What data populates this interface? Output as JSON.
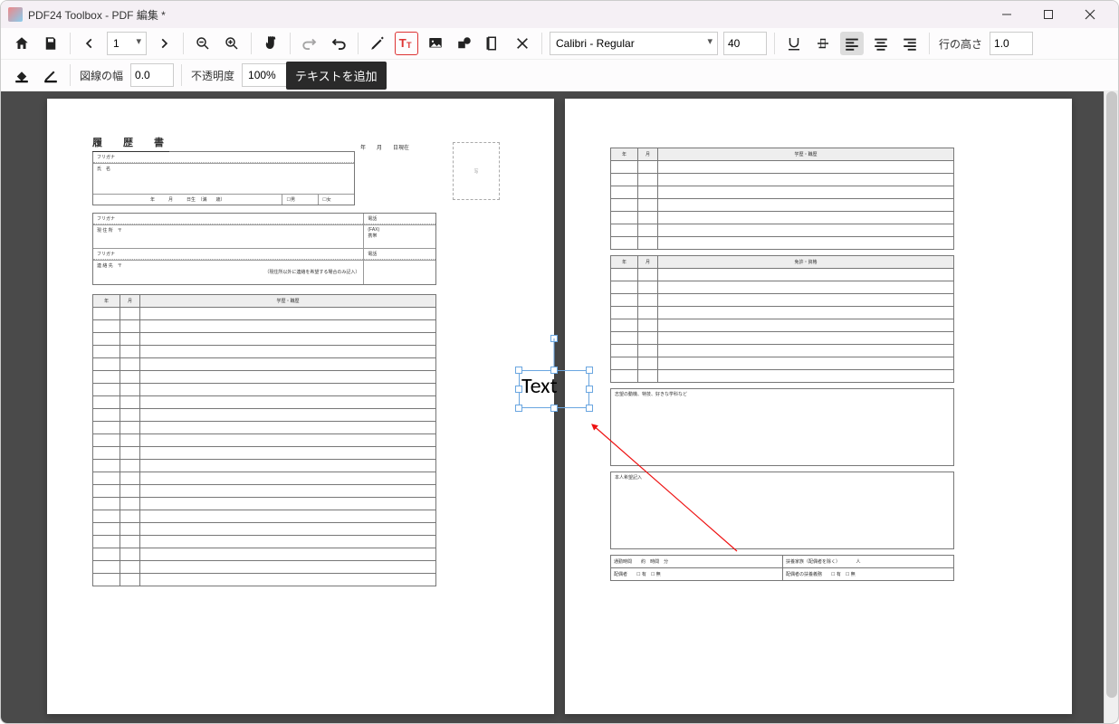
{
  "window": {
    "title": "PDF24 Toolbox - PDF 編集 *"
  },
  "toolbar": {
    "page_selector": "1",
    "font": "Calibri - Regular",
    "font_size": "40",
    "line_height_label": "行の高さ",
    "line_height": "1.0",
    "stroke_label": "図線の幅",
    "stroke_width": "0.0",
    "opacity_label": "不透明度",
    "opacity": "100%"
  },
  "tooltip": "テキストを追加",
  "textObject": {
    "value": "Text"
  },
  "doc": {
    "title": "履　歴　書",
    "date_suffix": "年　　月　　日現在",
    "furigana": "フリガナ",
    "name": "氏　名",
    "birth": "年　　　月　　　日生　（満　　歳）",
    "male": "男",
    "female": "女",
    "address_label": "現 住 所　〒",
    "contact_label": "連 絡 先　〒",
    "contact_note": "（現住所以外に連絡を希望する場合のみ記入）",
    "tel": "電話",
    "fax": "(FAX)",
    "mail": "携帯",
    "photo": "写",
    "history_hdr_y": "年",
    "history_hdr_m": "月",
    "history_hdr": "学歴・職歴",
    "license_hdr": "免許・資格",
    "motive_hdr": "志望の動機、特技、好きな学科など",
    "wish_hdr": "本人希望記入",
    "commute": "通勤時間",
    "commute_h": "約",
    "commute_hh": "時間",
    "commute_m": "分",
    "dependents": "扶養家族（配偶者を除く）",
    "people": "人",
    "spouse": "配偶者",
    "yes": "有",
    "no": "無",
    "spouse_dep": "配偶者の扶養義務"
  }
}
